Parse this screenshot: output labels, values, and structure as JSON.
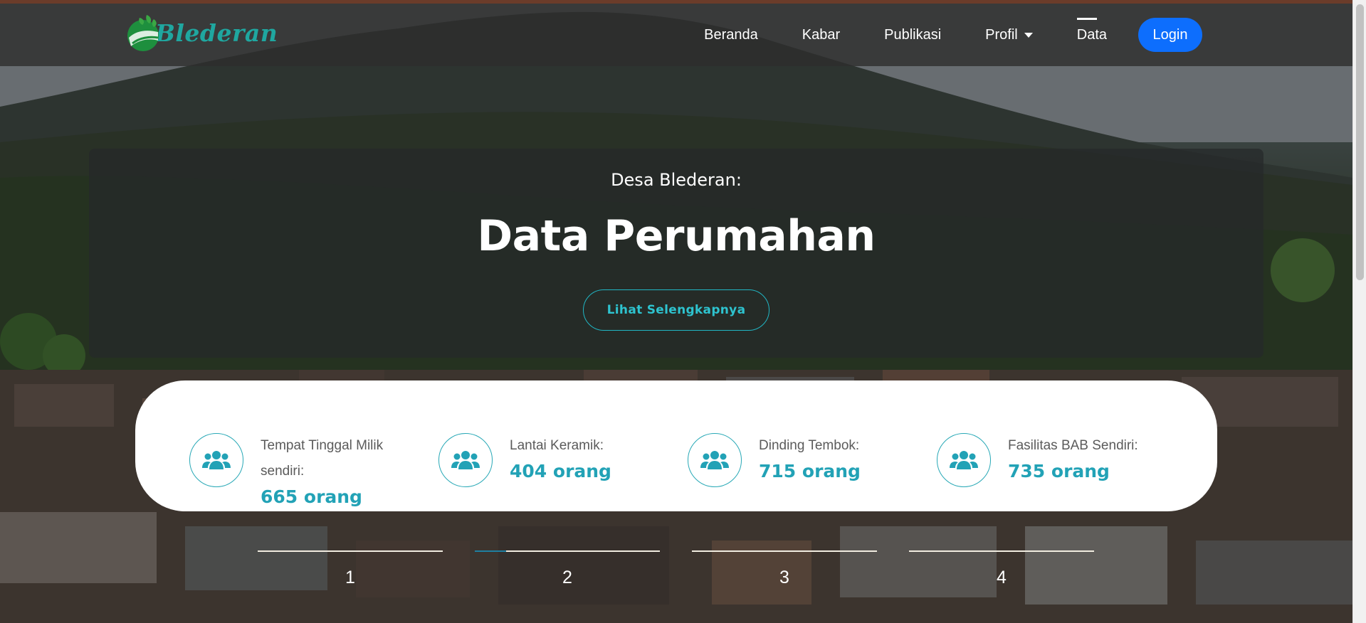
{
  "brand": {
    "name": "Blederan",
    "accent_color": "#1fa7a0"
  },
  "nav": {
    "items": [
      {
        "label": "Beranda",
        "active": false,
        "dropdown": false
      },
      {
        "label": "Kabar",
        "active": false,
        "dropdown": false
      },
      {
        "label": "Publikasi",
        "active": false,
        "dropdown": false
      },
      {
        "label": "Profil",
        "active": false,
        "dropdown": true
      },
      {
        "label": "Data",
        "active": true,
        "dropdown": false
      }
    ],
    "login_label": "Login",
    "login_color": "#0d6efd"
  },
  "hero": {
    "subtitle": "Desa Blederan:",
    "title": "Data Perumahan",
    "button_label": "Lihat Selengkapnya"
  },
  "stats": [
    {
      "label": "Tempat Tinggal Milik sendiri:",
      "value": "665 orang",
      "icon": "users-icon"
    },
    {
      "label": "Lantai Keramik:",
      "value": "404 orang",
      "icon": "users-icon"
    },
    {
      "label": "Dinding Tembok:",
      "value": "715 orang",
      "icon": "users-icon"
    },
    {
      "label": "Fasilitas BAB Sendiri:",
      "value": "735 orang",
      "icon": "users-icon"
    }
  ],
  "stats_accent": "#22a2b6",
  "carousel": {
    "indicators": [
      "1",
      "2",
      "3",
      "4"
    ],
    "active_index": 1,
    "active_progress": 0.17
  }
}
